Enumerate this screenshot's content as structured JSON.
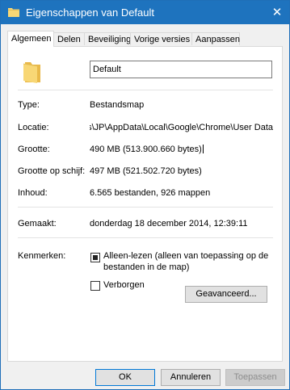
{
  "window": {
    "title": "Eigenschappen van Default",
    "close_glyph": "✕"
  },
  "tabs": [
    {
      "label": "Algemeen",
      "active": true
    },
    {
      "label": "Delen"
    },
    {
      "label": "Beveiliging"
    },
    {
      "label": "Vorige versies"
    },
    {
      "label": "Aanpassen"
    }
  ],
  "general": {
    "name_value": "Default",
    "type_label": "Type:",
    "type_value": "Bestandsmap",
    "location_label": "Locatie:",
    "location_value": "C:\\Users\\JP\\AppData\\Local\\Google\\Chrome\\User Data",
    "size_label": "Grootte:",
    "size_value": "490 MB (513.900.660 bytes)",
    "disk_size_label": "Grootte op schijf:",
    "disk_size_value": "497 MB (521.502.720 bytes)",
    "contents_label": "Inhoud:",
    "contents_value": "6.565 bestanden, 926 mappen",
    "created_label": "Gemaakt:",
    "created_value": "donderdag 18 december 2014, 12:39:11",
    "attributes_label": "Kenmerken:",
    "readonly_label_line1": "Alleen-lezen (alleen van toepassing op de",
    "readonly_label_line2": "bestanden in de map)",
    "readonly_state": "indeterminate",
    "hidden_label": "Verborgen",
    "hidden_checked": false,
    "advanced_button": "Geavanceerd..."
  },
  "footer": {
    "ok": "OK",
    "cancel": "Annuleren",
    "apply": "Toepassen"
  },
  "colors": {
    "titlebar": "#1e73be",
    "folder": "#f8d775",
    "accent_border": "#0078d7"
  },
  "icons": {
    "title_icon": "folder-icon",
    "big_icon": "folder-icon"
  }
}
